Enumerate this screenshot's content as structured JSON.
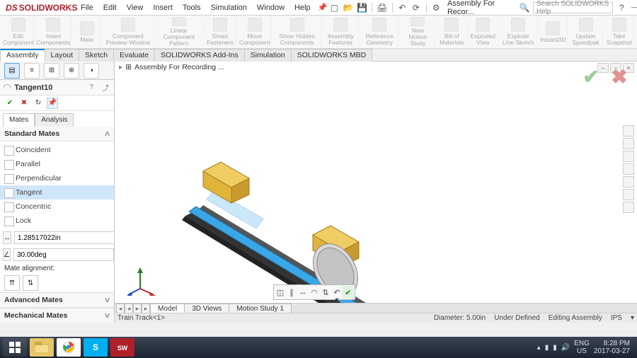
{
  "app": {
    "name": "SOLIDWORKS",
    "logo_prefix": "DS"
  },
  "menus": [
    "File",
    "Edit",
    "View",
    "Insert",
    "Tools",
    "Simulation",
    "Window",
    "Help"
  ],
  "doc_title": "Assembly For Recor...",
  "search_placeholder": "Search SOLIDWORKS Help",
  "ribbon": [
    {
      "label": "Edit\nComponent"
    },
    {
      "label": "Insert\nComponents"
    },
    {
      "label": "Mate"
    },
    {
      "label": "Component\nPreview\nWindow"
    },
    {
      "label": "Linear Component\nPattern"
    },
    {
      "label": "Smart\nFasteners"
    },
    {
      "label": "Move\nComponent"
    },
    {
      "label": "Show\nHidden\nComponents"
    },
    {
      "label": "Assembly\nFeatures"
    },
    {
      "label": "Reference\nGeometry"
    },
    {
      "label": "New\nMotion\nStudy"
    },
    {
      "label": "Bill of\nMaterials"
    },
    {
      "label": "Exploded\nView"
    },
    {
      "label": "Explode\nLine\nSketch"
    },
    {
      "label": "Instant3D"
    },
    {
      "label": "Update\nSpeedpak"
    },
    {
      "label": "Take\nSnapshot"
    }
  ],
  "tabs": [
    "Assembly",
    "Layout",
    "Sketch",
    "Evaluate",
    "SOLIDWORKS Add-Ins",
    "Simulation",
    "SOLIDWORKS MBD"
  ],
  "active_tab": "Assembly",
  "property_manager": {
    "title": "Tangent10",
    "subtab_mates": "Mates",
    "subtab_analysis": "Analysis",
    "section_standard": "Standard Mates",
    "mates": [
      "Coincident",
      "Parallel",
      "Perpendicular",
      "Tangent",
      "Concentric",
      "Lock"
    ],
    "selected_mate": "Tangent",
    "distance_value": "1.28517022in",
    "angle_value": "30.00deg",
    "mate_alignment_label": "Mate alignment:",
    "section_advanced": "Advanced Mates",
    "section_mechanical": "Mechanical Mates"
  },
  "breadcrumb": "Assembly For Recording  ...",
  "bottom_tabs": [
    "Model",
    "3D Views",
    "Motion Study 1"
  ],
  "active_bottom_tab": "Model",
  "status": {
    "left": "Train Track<1>",
    "diameter": "Diameter: 5.00in",
    "defined": "Under Defined",
    "mode": "Editing Assembly",
    "units": "IPS"
  },
  "taskbar": {
    "lang": "ENG",
    "region": "US",
    "time": "8:28 PM",
    "date": "2017-03-27"
  }
}
